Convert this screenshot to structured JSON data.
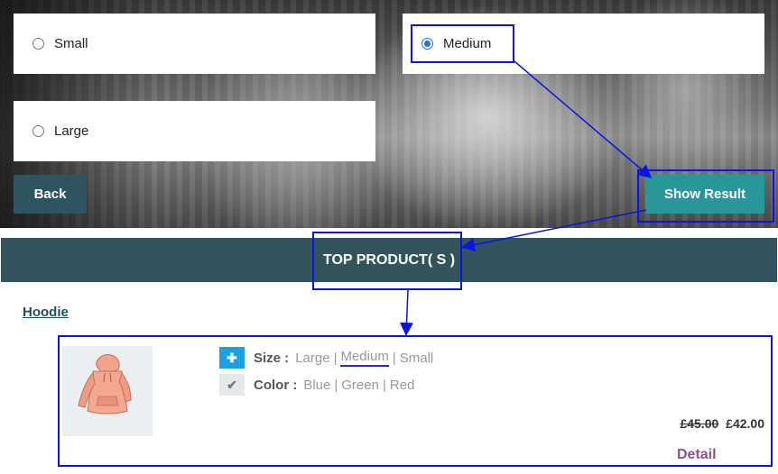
{
  "options": [
    {
      "label": "Small",
      "checked": false
    },
    {
      "label": "Medium",
      "checked": true
    },
    {
      "label": "Large",
      "checked": false
    }
  ],
  "buttons": {
    "back": "Back",
    "show_result": "Show Result"
  },
  "banner": {
    "title": "TOP PRODUCT( S )"
  },
  "product": {
    "name": "Hoodie",
    "image_icon": "hoodie-image",
    "size": {
      "label": "Size :",
      "values": [
        "Large",
        "Medium",
        "Small"
      ],
      "selected": "Medium",
      "sep": "|"
    },
    "color": {
      "label": "Color :",
      "values": [
        "Blue",
        "Green",
        "Red"
      ],
      "sep": "|"
    },
    "price_old": "£45.00",
    "price_new": "£42.00",
    "detail": "Detail"
  },
  "colors": {
    "accent_teal": "#27979a",
    "dark_teal": "#2f5461",
    "banner": "#34545d",
    "annotation": "#0a14e6",
    "detail": "#8a5288"
  }
}
